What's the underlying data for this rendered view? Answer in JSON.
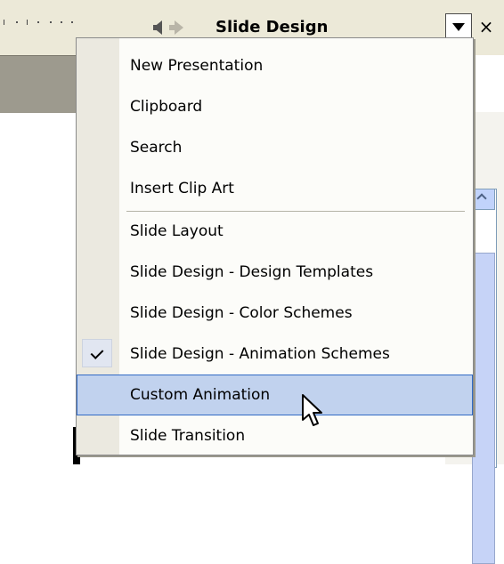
{
  "task_pane": {
    "title": "Slide Design",
    "back_icon": "back-arrow-icon",
    "forward_icon": "forward-arrow-icon",
    "dropdown_icon": "chevron-down-icon",
    "close_glyph": "×"
  },
  "menu": {
    "items": [
      {
        "label": "New Presentation"
      },
      {
        "label": "Clipboard"
      },
      {
        "label": "Search"
      },
      {
        "label": "Insert Clip Art"
      },
      {
        "label": "Slide Layout"
      },
      {
        "label": "Slide Design - Design Templates"
      },
      {
        "label": "Slide Design - Color Schemes"
      },
      {
        "label": "Slide Design - Animation Schemes",
        "checked": true
      },
      {
        "label": "Custom Animation",
        "hovered": true
      },
      {
        "label": "Slide Transition"
      }
    ]
  },
  "colors": {
    "menu_background": "#fcfcf9",
    "menu_gutter": "#ebe9e0",
    "hover_background": "#c1d2ee",
    "hover_border": "#316ac5"
  }
}
